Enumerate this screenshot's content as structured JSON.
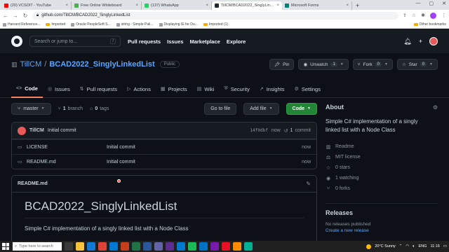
{
  "browser": {
    "tabs": [
      {
        "title": "(20) VCSOIT - YouTube",
        "favicon_color": "#ff0000",
        "active": false
      },
      {
        "title": "Free Online Whiteboard",
        "favicon_color": "#4caf50",
        "active": false
      },
      {
        "title": "(137) WhatsApp",
        "favicon_color": "#25d366",
        "active": false
      },
      {
        "title": "TillCM/BCAD2022_SinglyLinked...",
        "favicon_color": "#24292f",
        "active": true
      },
      {
        "title": "Microsoft Forms",
        "favicon_color": "#008272",
        "active": false
      }
    ],
    "new_tab": "+",
    "address": "github.com/TillCM/BCAD2022_SinglyLinkedList",
    "bookmarks": [
      "Harvard Reference...",
      "Imported",
      "Oracle PeopleSoft S...",
      "string - Simple Pali...",
      "Displaying IE for Du...",
      "Imported (1)"
    ],
    "other_bookmarks": "Other bookmarks"
  },
  "github": {
    "search_placeholder": "Search or jump to...",
    "search_shortcut": "/",
    "nav": [
      "Pull requests",
      "Issues",
      "Marketplace",
      "Explore"
    ],
    "plus": "+",
    "repo": {
      "owner": "TillCM",
      "separator": "/",
      "name": "BCAD2022_SinglyLinkedList",
      "visibility": "Public",
      "pin": "Pin",
      "unwatch": "Unwatch",
      "watch_count": "1",
      "fork": "Fork",
      "fork_count": "0",
      "star": "Star",
      "star_count": "0"
    },
    "tabs": [
      {
        "label": "Code",
        "icon": "<>"
      },
      {
        "label": "Issues",
        "icon": "◎"
      },
      {
        "label": "Pull requests",
        "icon": "⇅"
      },
      {
        "label": "Actions",
        "icon": "▷"
      },
      {
        "label": "Projects",
        "icon": "▦"
      },
      {
        "label": "Wiki",
        "icon": "▤"
      },
      {
        "label": "Security",
        "icon": "⛨"
      },
      {
        "label": "Insights",
        "icon": "↗"
      },
      {
        "label": "Settings",
        "icon": "⚙"
      }
    ],
    "branch": "master",
    "branch_count": "1",
    "branch_word": "branch",
    "tag_count": "0",
    "tag_word": "tags",
    "go_to_file": "Go to file",
    "add_file": "Add file",
    "code_btn": "Code",
    "commit": {
      "author": "TillCM",
      "message": "Initial commit",
      "sha": "14f0dbf",
      "time": "now",
      "count": "1",
      "count_word": "commit"
    },
    "files": [
      {
        "name": "LICENSE",
        "commit": "Initial commit",
        "age": "now"
      },
      {
        "name": "README.md",
        "commit": "Initial commit",
        "age": "now"
      }
    ],
    "readme": {
      "filename": "README.md",
      "heading": "BCAD2022_SinglyLinkedList",
      "body": "Simple C# implementation of a singly linked list with a Node Class"
    },
    "about": {
      "title": "About",
      "description": "Simple C# implementation of a singly linked list with a Node Class",
      "items": [
        {
          "icon": "book-icon",
          "glyph": "▥",
          "label": "Readme"
        },
        {
          "icon": "scale-icon",
          "glyph": "⚖",
          "label": "MIT license"
        },
        {
          "icon": "star-icon",
          "glyph": "☆",
          "label": "0 stars"
        },
        {
          "icon": "eye-icon",
          "glyph": "◉",
          "label": "1 watching"
        },
        {
          "icon": "fork-icon",
          "glyph": "⑂",
          "label": "0 forks"
        }
      ]
    },
    "releases": {
      "title": "Releases",
      "none": "No releases published",
      "create": "Create a new release"
    }
  },
  "taskbar": {
    "search": "Type here to search",
    "weather": "20°C  Sunny",
    "lang": "ENG",
    "time": "11:16"
  }
}
